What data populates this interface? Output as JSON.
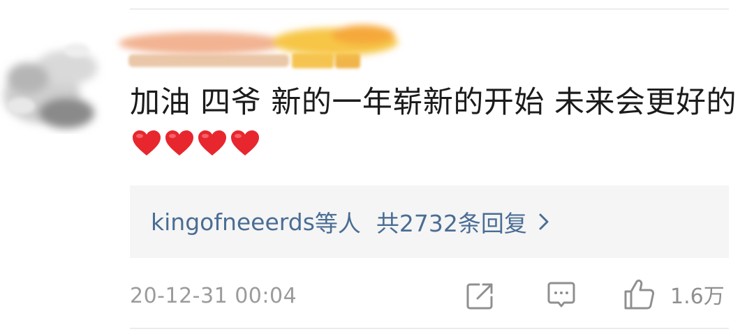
{
  "comment": {
    "text": "加油 四爷 新的一年崭新的开始 未来会更好的",
    "emoji_count": 4,
    "emoji": "heart"
  },
  "replies": {
    "users": "kingofneeerds",
    "suffix": "等人",
    "total_text": "共2732条回复"
  },
  "footer": {
    "timestamp": "20-12-31 00:04",
    "like_count": "1.6万"
  },
  "colors": {
    "text": "#1b1b1b",
    "link": "#4a6d94",
    "meta": "#9b9b9b",
    "reply_bg": "#f5f5f5",
    "heart": "#e8262e"
  }
}
